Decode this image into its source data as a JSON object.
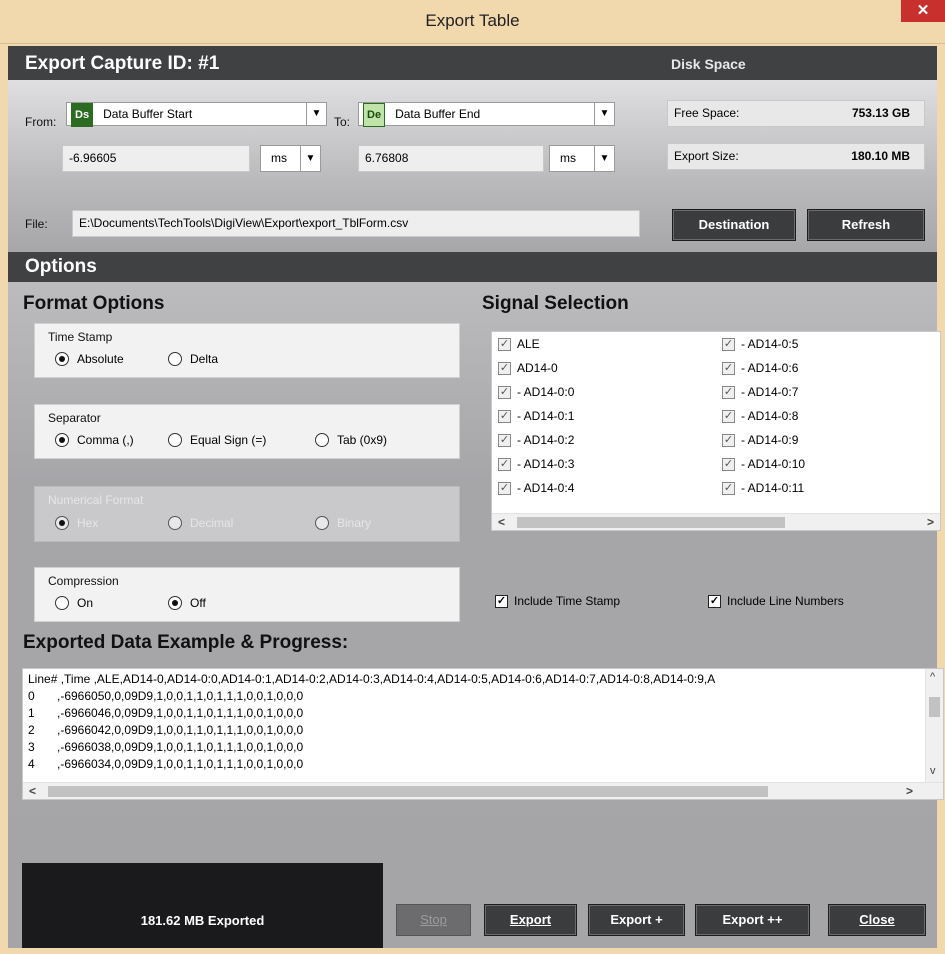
{
  "window": {
    "title": "Export Table",
    "close_glyph": "✕"
  },
  "header": {
    "title": "Export Capture ID: #1",
    "disk_space_label": "Disk Space"
  },
  "range": {
    "from_label": "From:",
    "from_tag": "Ds",
    "from_value": "Data Buffer Start",
    "to_label": "To:",
    "to_tag": "De",
    "to_value": "Data Buffer End",
    "from_time": "-6.96605",
    "from_unit": "ms",
    "to_time": "6.76808",
    "to_unit": "ms"
  },
  "disk": {
    "free_label": "Free Space:",
    "free_value": "753.13 GB",
    "size_label": "Export Size:",
    "size_value": "180.10 MB"
  },
  "file": {
    "label": "File:",
    "path": "E:\\Documents\\TechTools\\DigiView\\Export\\export_TblForm.csv",
    "destination_button": "Destination",
    "refresh_button": "Refresh"
  },
  "options": {
    "title": "Options",
    "format_title": "Format Options",
    "timestamp": {
      "title": "Time Stamp",
      "absolute": "Absolute",
      "delta": "Delta"
    },
    "separator": {
      "title": "Separator",
      "comma": "Comma (,)",
      "equal": "Equal Sign (=)",
      "tab": "Tab (0x9)"
    },
    "numerical": {
      "title": "Numerical Format",
      "hex": "Hex",
      "decimal": "Decimal",
      "binary": "Binary"
    },
    "compression": {
      "title": "Compression",
      "on": "On",
      "off": "Off"
    }
  },
  "signals": {
    "title": "Signal Selection",
    "col1": [
      "ALE",
      "AD14-0",
      " - AD14-0:0",
      " - AD14-0:1",
      " - AD14-0:2",
      " - AD14-0:3",
      " - AD14-0:4"
    ],
    "col2": [
      " - AD14-0:5",
      " - AD14-0:6",
      " - AD14-0:7",
      " - AD14-0:8",
      " - AD14-0:9",
      " - AD14-0:10",
      " - AD14-0:11"
    ],
    "include_timestamp": "Include Time Stamp",
    "include_line_numbers": "Include Line Numbers"
  },
  "example": {
    "title": "Exported Data Example & Progress:",
    "header_line": "Line# ,Time    ,ALE,AD14-0,AD14-0:0,AD14-0:1,AD14-0:2,AD14-0:3,AD14-0:4,AD14-0:5,AD14-0:6,AD14-0:7,AD14-0:8,AD14-0:9,A",
    "rows": [
      {
        "num": "0",
        "data": ",-6966050,0,09D9,1,0,0,1,1,0,1,1,1,0,0,1,0,0,0"
      },
      {
        "num": "1",
        "data": ",-6966046,0,09D9,1,0,0,1,1,0,1,1,1,0,0,1,0,0,0"
      },
      {
        "num": "2",
        "data": ",-6966042,0,09D9,1,0,0,1,1,0,1,1,1,0,0,1,0,0,0"
      },
      {
        "num": "3",
        "data": ",-6966038,0,09D9,1,0,0,1,1,0,1,1,1,0,0,1,0,0,0"
      },
      {
        "num": "4",
        "data": ",-6966034,0,09D9,1,0,0,1,1,0,1,1,1,0,0,1,0,0,0"
      }
    ]
  },
  "progress": {
    "text": "181.62 MB Exported"
  },
  "footer": {
    "stop": "Stop",
    "export": "Export",
    "export_plus": "Export +",
    "export_plus_plus": "Export ++",
    "close": "Close"
  },
  "colors": {
    "title_bar": "#f1d8ad",
    "header_bar": "#404143",
    "button": "#3b3c3e",
    "close_button": "#c7302c",
    "tag_ds": "#2c6b22",
    "tag_de": "#bfe3a8"
  }
}
